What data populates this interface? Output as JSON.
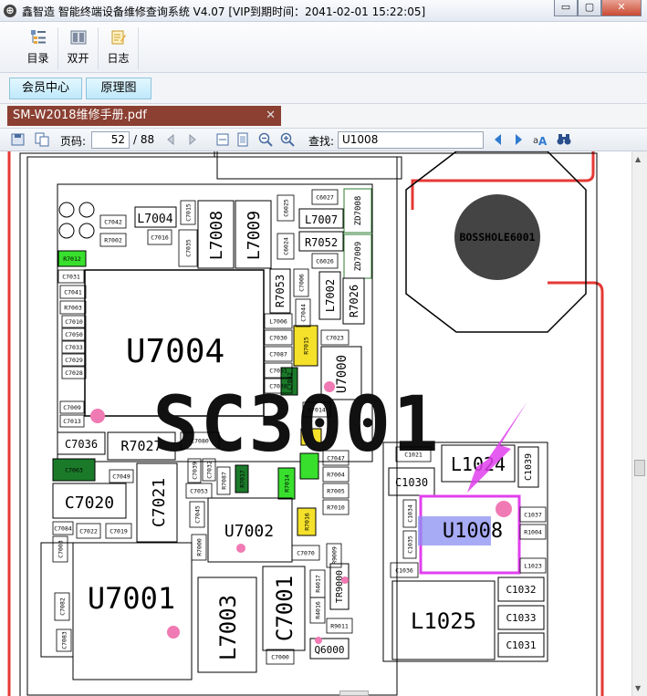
{
  "window": {
    "title": "鑫智造 智能终端设备维修查询系统 V4.07 [VIP到期时间：2041-02-01 15:22:05]",
    "minimize_glyph": "▭",
    "maximize_glyph": "▢",
    "close_glyph": "✕"
  },
  "toolbar": {
    "items": [
      {
        "label": "目录",
        "icon": "catalog-icon"
      },
      {
        "label": "双开",
        "icon": "dual-open-icon"
      },
      {
        "label": "日志",
        "icon": "log-icon"
      }
    ]
  },
  "tabs": [
    {
      "label": "会员中心"
    },
    {
      "label": "原理图"
    }
  ],
  "document_tab": {
    "label": "SM-W2018维修手册.pdf",
    "close_glyph": "✕"
  },
  "pdf_toolbar": {
    "page_label": "页码:",
    "page_value": "52",
    "page_total": "/ 88",
    "find_label": "查找:",
    "find_value": "U1008"
  },
  "schematic": {
    "big_label": "SC3001",
    "boss_hole": "BOSSHOLE6001",
    "highlight": "U1008",
    "large_components": [
      "U7004",
      "U7001",
      "U7002",
      "U7000",
      "L7003",
      "C7001",
      "L1025",
      "L1024",
      "C7021",
      "C7020"
    ],
    "medium_components": [
      "L7008",
      "L7009",
      "L7004",
      "L7007",
      "R7052",
      "R7053",
      "L7002",
      "R7026",
      "R7027",
      "C7036",
      "C1030",
      "C1032",
      "C1033",
      "C1031",
      "C1039",
      "TR9000",
      "Q6000",
      "ZD7008",
      "ZD7009"
    ],
    "small_components": [
      "C7042",
      "R7002",
      "C7016",
      "C7015",
      "C7035",
      "C6025",
      "C6024",
      "C6027",
      "C6026",
      "R7012",
      "C7031",
      "C7041",
      "R7003",
      "C7010",
      "C7050",
      "C7033",
      "C7029",
      "C7028",
      "C7009",
      "C7013",
      "C7063",
      "C7049",
      "C7084",
      "C7022",
      "C7019",
      "C7003",
      "C7082",
      "C7083",
      "C7006",
      "C7044",
      "L7006",
      "C7030",
      "C7087",
      "C7051",
      "C7038",
      "R7015",
      "C7023",
      "C7052",
      "C7014",
      "C7047",
      "R7004",
      "R7005",
      "R7010",
      "R7014",
      "R7016",
      "R7017",
      "C7039",
      "C7032",
      "C7053",
      "R7087",
      "C7045",
      "R7000",
      "C7070",
      "R4017",
      "R4016",
      "R9011",
      "C7000",
      "C1021",
      "C1034",
      "C1035",
      "C1036",
      "C1037",
      "R1004",
      "L1023",
      "C7080",
      "R9009"
    ],
    "marker_color": "#e040ee",
    "accent_red": "#e53935",
    "dot_color": "#f07ab3",
    "highlight_fill": "#8a8df0"
  }
}
